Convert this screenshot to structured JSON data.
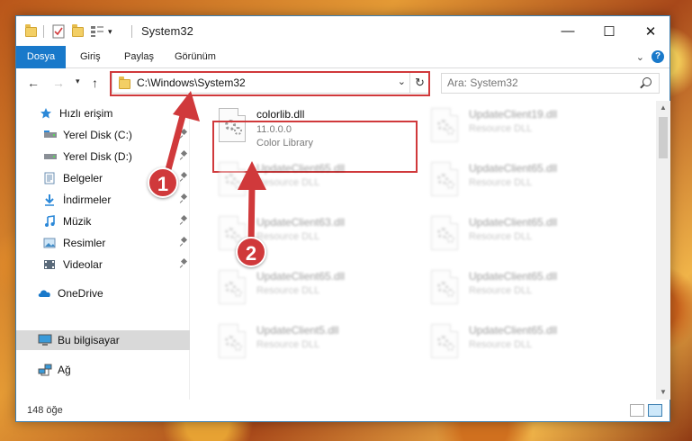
{
  "window": {
    "title": "System32",
    "controls": {
      "minimize": "—",
      "maximize": "☐",
      "close": "✕"
    }
  },
  "ribbon": {
    "tabs": [
      "Dosya",
      "Giriş",
      "Paylaş",
      "Görünüm"
    ],
    "help": "?"
  },
  "address": {
    "path": "C:\\Windows\\System32",
    "search_placeholder": "Ara: System32"
  },
  "sidebar": {
    "items": [
      {
        "label": "Hızlı erişim",
        "icon": "star-icon",
        "pinned": false
      },
      {
        "label": "Yerel Disk (C:)",
        "icon": "drive-icon",
        "pinned": true
      },
      {
        "label": "Yerel Disk (D:)",
        "icon": "drive-icon",
        "pinned": true
      },
      {
        "label": "Belgeler",
        "icon": "documents-icon",
        "pinned": true
      },
      {
        "label": "İndirmeler",
        "icon": "download-icon",
        "pinned": true
      },
      {
        "label": "Müzik",
        "icon": "music-icon",
        "pinned": true
      },
      {
        "label": "Resimler",
        "icon": "pictures-icon",
        "pinned": true
      },
      {
        "label": "Videolar",
        "icon": "video-icon",
        "pinned": true
      },
      {
        "label": "OneDrive",
        "icon": "cloud-icon",
        "pinned": false
      },
      {
        "label": "Bu bilgisayar",
        "icon": "computer-icon",
        "pinned": false,
        "selected": true
      },
      {
        "label": "Ağ",
        "icon": "network-icon",
        "pinned": false
      }
    ]
  },
  "files": {
    "highlighted": {
      "name": "colorlib.dll",
      "version": "11.0.0.0",
      "description": "Color Library"
    },
    "others": [
      {
        "name": "UpdateClient19.dll",
        "description": "Resource DLL"
      },
      {
        "name": "UpdateClient65.dll",
        "description": "Resource DLL"
      },
      {
        "name": "UpdateClient65.dll",
        "description": "Resource DLL"
      },
      {
        "name": "UpdateClient63.dll",
        "description": "Resource DLL"
      },
      {
        "name": "UpdateClient65.dll",
        "description": "Resource DLL"
      },
      {
        "name": "UpdateClient65.dll",
        "description": "Resource DLL"
      },
      {
        "name": "UpdateClient65.dll",
        "description": "Resource DLL"
      },
      {
        "name": "UpdateClient5.dll",
        "description": "Resource DLL"
      },
      {
        "name": "UpdateClient65.dll",
        "description": "Resource DLL"
      }
    ]
  },
  "status": {
    "count": "148 öğe"
  },
  "annotations": {
    "badge1": "1",
    "badge2": "2",
    "color": "#d0393b"
  },
  "colors": {
    "accent": "#1979ca",
    "highlight": "#d0393b"
  }
}
